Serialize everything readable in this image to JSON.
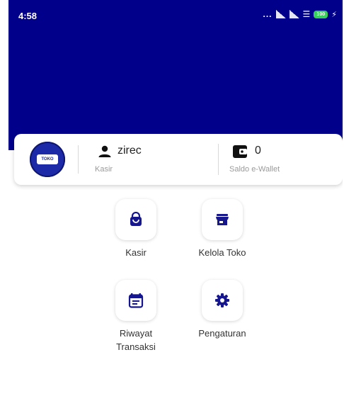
{
  "status_bar": {
    "time": "4:58",
    "dots": "...",
    "battery_level": "100"
  },
  "profile": {
    "logo_text": "TOKO",
    "username": "zirec",
    "role": "Kasir",
    "balance": "0",
    "balance_label": "Saldo e-Wallet"
  },
  "menu": {
    "kasir": "Kasir",
    "kelola_toko": "Kelola Toko",
    "riwayat_line1": "Riwayat",
    "riwayat_line2": "Transaksi",
    "pengaturan": "Pengaturan"
  },
  "colors": {
    "primary": "#00008a",
    "icon": "#16178f",
    "background": "#ffffff"
  },
  "icons": [
    "user-icon",
    "wallet-icon",
    "shopping-bag-icon",
    "store-icon",
    "calendar-icon",
    "gear-icon"
  ]
}
